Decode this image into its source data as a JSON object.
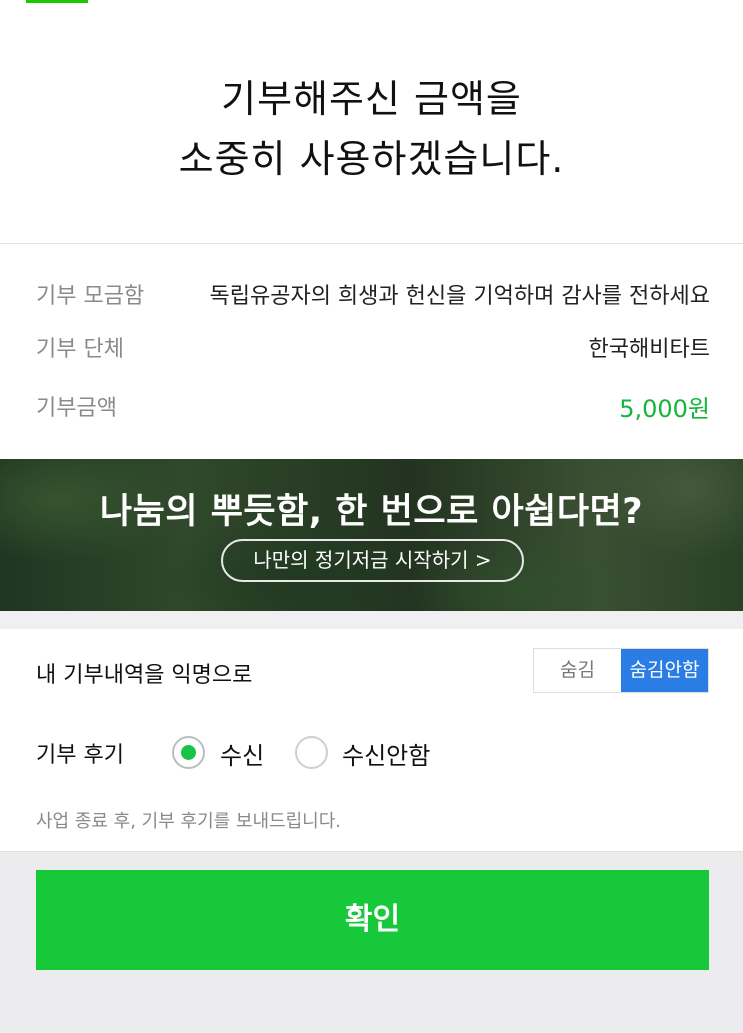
{
  "header": {
    "title_line1": "기부해주신 금액을",
    "title_line2": "소중히 사용하겠습니다."
  },
  "donation_info": {
    "fund_label": "기부 모금함",
    "fund_value": "독립유공자의 희생과 헌신을 기억하며 감사를 전하세요",
    "org_label": "기부 단체",
    "org_value": "한국해비타트",
    "amount_label": "기부금액",
    "amount_value": "5,000원"
  },
  "banner": {
    "headline": "나눔의 뿌듯함, 한 번으로 아쉽다면?",
    "button_label": "나만의 정기저금 시작하기 >"
  },
  "anonymity": {
    "label": "내 기부내역을 익명으로",
    "options": [
      "숨김",
      "숨김안함"
    ],
    "selected": "숨김안함"
  },
  "review": {
    "label": "기부 후기",
    "option_receive": "수신",
    "option_decline": "수신안함",
    "selected": "수신",
    "note": "사업 종료 후, 기부 후기를 보내드립니다."
  },
  "footer": {
    "confirm_label": "확인"
  },
  "colors": {
    "accent_green": "#16c83a",
    "toggle_blue": "#2b7de6",
    "amount_green": "#16b43a"
  }
}
